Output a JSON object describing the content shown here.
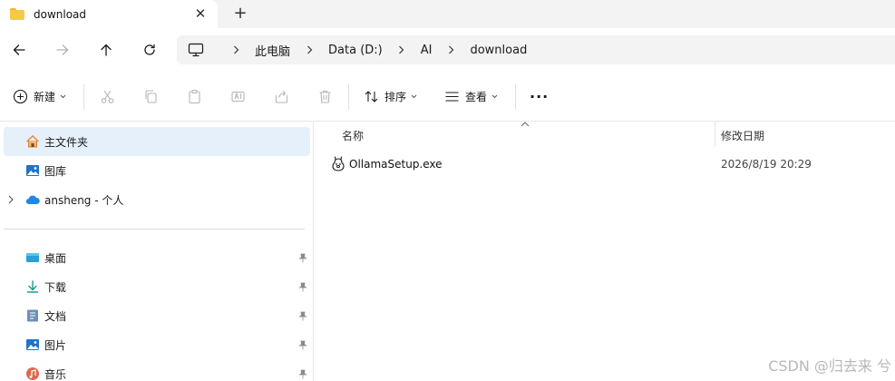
{
  "tab": {
    "title": "download",
    "close_glyph": "✕",
    "new_tab_glyph": "+"
  },
  "nav": {
    "back_icon": "arrow-left-icon",
    "forward_icon": "arrow-right-icon",
    "up_icon": "arrow-up-icon",
    "refresh_icon": "refresh-icon"
  },
  "address": {
    "root_icon": "this-pc-icon",
    "crumbs": [
      "此电脑",
      "Data (D:)",
      "AI",
      "download"
    ]
  },
  "toolbar": {
    "new_label": "新建",
    "sort_label": "排序",
    "view_label": "查看",
    "more_glyph": "···",
    "icons": [
      "cut-icon",
      "copy-icon",
      "paste-icon",
      "rename-icon",
      "share-icon",
      "delete-icon"
    ]
  },
  "sidebar": {
    "items": [
      {
        "label": "主文件夹",
        "icon": "home-icon",
        "selected": true
      },
      {
        "label": "图库",
        "icon": "gallery-icon"
      },
      {
        "label": "ansheng - 个人",
        "icon": "onedrive-icon"
      },
      {
        "label": "桌面",
        "icon": "desktop-icon",
        "pinned": true
      },
      {
        "label": "下载",
        "icon": "download-icon",
        "pinned": true
      },
      {
        "label": "文档",
        "icon": "documents-icon",
        "pinned": true
      },
      {
        "label": "图片",
        "icon": "pictures-icon",
        "pinned": true
      },
      {
        "label": "音乐",
        "icon": "music-icon",
        "pinned": true
      }
    ]
  },
  "content": {
    "columns": {
      "name": "名称",
      "date_modified": "修改日期"
    },
    "files": [
      {
        "name": "OllamaSetup.exe",
        "date_modified": "2026/8/19 20:29",
        "icon": "ollama-icon"
      }
    ]
  },
  "watermark": "CSDN @归去来 兮",
  "colors": {
    "accent_folder": "#f6c945",
    "selected_bg": "#e6f0fb",
    "chrome_bg": "#f3f3f3"
  }
}
